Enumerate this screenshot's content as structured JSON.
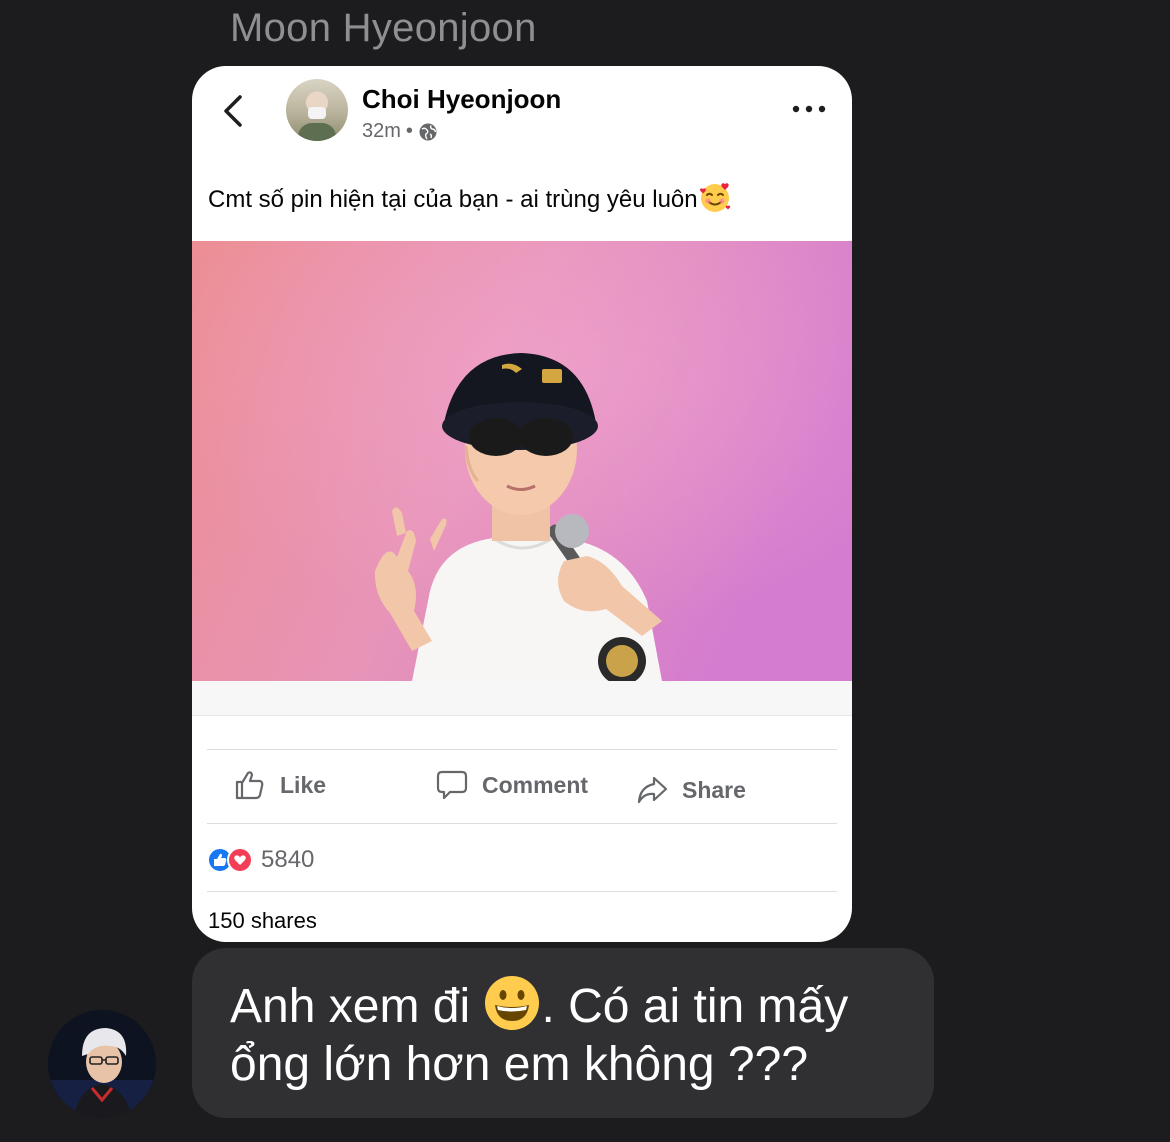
{
  "thread": {
    "sender_name": "Moon Hyeonjoon"
  },
  "shared_post": {
    "author": "Choi Hyeonjoon",
    "time": "32m",
    "separator": "•",
    "text": "Cmt số pin hiện tại của bạn - ai trùng yêu luôn",
    "text_emoji": "smiling-face-with-hearts",
    "actions": {
      "like": "Like",
      "comment": "Comment",
      "share": "Share"
    },
    "reaction_count": "5840",
    "shares": "150 shares",
    "icons": [
      "back-chevron-icon",
      "globe-icon",
      "more-icon",
      "like-icon",
      "comment-icon",
      "share-icon",
      "like-reaction-icon",
      "love-reaction-icon"
    ]
  },
  "message": {
    "line1_before": "Anh xem đi ",
    "line1_after": ". Có ai tin mấy",
    "line2": "ổng lớn hơn em không ???",
    "emoji": "grinning-face"
  },
  "colors": {
    "background": "#1c1c1e",
    "bubble": "#303033",
    "card": "#ffffff",
    "like_blue": "#1877f2",
    "love_red": "#f33e58",
    "photo_pink": "#e8879c",
    "photo_magenta": "#d57ed0"
  }
}
